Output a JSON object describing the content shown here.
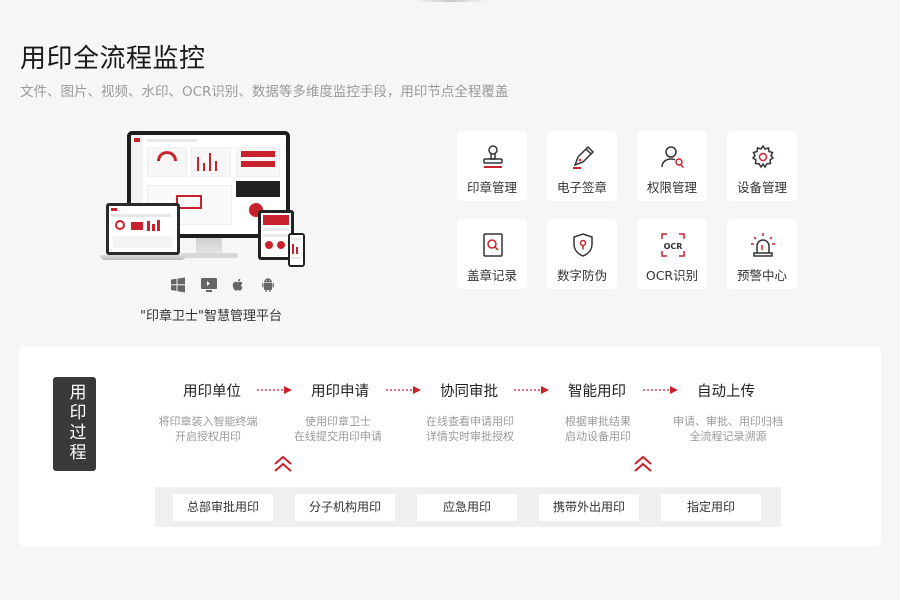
{
  "header": {
    "title": "用印全流程监控",
    "subtitle": "文件、图片、视频、水印、OCR识别、数据等多维度监控手段，用印节点全程覆盖"
  },
  "platform": {
    "caption": "\"印章卫士\"智慧管理平台",
    "os_icons": [
      "windows-icon",
      "monitor-icon",
      "apple-icon",
      "android-icon"
    ]
  },
  "features": [
    {
      "label": "印章管理",
      "icon": "stamp-icon"
    },
    {
      "label": "电子签章",
      "icon": "pen-icon"
    },
    {
      "label": "权限管理",
      "icon": "user-key-icon"
    },
    {
      "label": "设备管理",
      "icon": "gear-icon"
    },
    {
      "label": "盖章记录",
      "icon": "document-search-icon"
    },
    {
      "label": "数字防伪",
      "icon": "shield-lock-icon"
    },
    {
      "label": "OCR识别",
      "icon": "ocr-icon"
    },
    {
      "label": "预警中心",
      "icon": "alarm-icon"
    }
  ],
  "process": {
    "tag": "用印过程",
    "steps": [
      {
        "title": "用印单位",
        "desc1": "将印章装入智能终端",
        "desc2": "开启授权用印"
      },
      {
        "title": "用印申请",
        "desc1": "使用印章卫士",
        "desc2": "在线提交用印申请"
      },
      {
        "title": "协同审批",
        "desc1": "在线查看申请用印",
        "desc2": "详情实时审批授权"
      },
      {
        "title": "智能用印",
        "desc1": "根据审批结果",
        "desc2": "启动设备用印"
      },
      {
        "title": "自动上传",
        "desc1": "申请、审批、用印归档",
        "desc2": "全流程记录溯源"
      }
    ],
    "sub_items": [
      "总部审批用印",
      "分子机构用印",
      "应急用印",
      "携带外出用印",
      "指定用印"
    ]
  },
  "colors": {
    "accent": "#c8232c",
    "dark": "#3a3a3a",
    "muted": "#9a9a9a"
  }
}
